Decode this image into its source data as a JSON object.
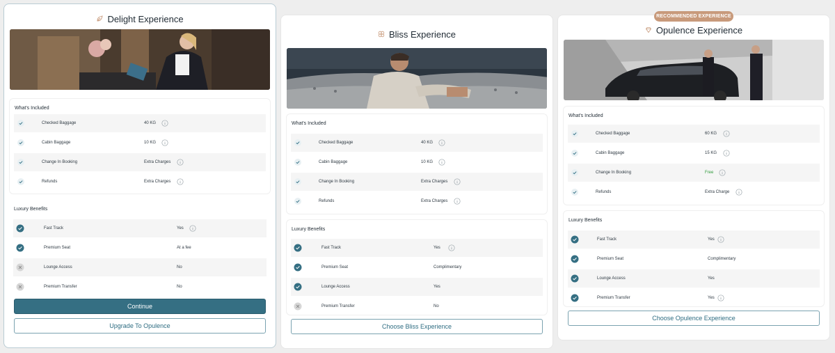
{
  "badge": "RECOMMENDED EXPERIENCE",
  "colors": {
    "accent": "#356f83",
    "check": "#2f6d82",
    "free": "#2e9a3a",
    "badge": "#c89a7b"
  },
  "cards": [
    {
      "title": "Delight Experience",
      "icon": "leaf-icon",
      "hero": "hotel-reception-photo",
      "included_title": "What's Included",
      "included": [
        {
          "label": "Checked Baggage",
          "value": "40 KG"
        },
        {
          "label": "Cabin Baggage",
          "value": "10 KG"
        },
        {
          "label": "Change In Booking",
          "value": "Extra Charges"
        },
        {
          "label": "Refunds",
          "value": "Extra Charges"
        }
      ],
      "benefits_title": "Luxury Benefits",
      "benefits": [
        {
          "label": "Fast Track",
          "value": "Yes",
          "included": true
        },
        {
          "label": "Premium Seat",
          "value": "At a fee",
          "included": true
        },
        {
          "label": "Lounge Access",
          "value": "No",
          "included": false
        },
        {
          "label": "Premium Transfer",
          "value": "No",
          "included": false
        }
      ],
      "primary_button": "Continue",
      "secondary_button": "Upgrade To Opulence"
    },
    {
      "title": "Bliss Experience",
      "icon": "flower-icon",
      "hero": "lounge-sofa-photo",
      "included_title": "What's Included",
      "included": [
        {
          "label": "Checked Baggage",
          "value": "40 KG"
        },
        {
          "label": "Cabin Baggage",
          "value": "10 KG"
        },
        {
          "label": "Change In Booking",
          "value": "Extra Charges"
        },
        {
          "label": "Refunds",
          "value": "Extra Charges"
        }
      ],
      "benefits_title": "Luxury Benefits",
      "benefits": [
        {
          "label": "Fast Track",
          "value": "Yes",
          "included": true
        },
        {
          "label": "Premium Seat",
          "value": "Complimentary",
          "included": true
        },
        {
          "label": "Lounge Access",
          "value": "Yes",
          "included": true
        },
        {
          "label": "Premium Transfer",
          "value": "No",
          "included": false
        }
      ],
      "secondary_button": "Choose Bliss Experience"
    },
    {
      "title": "Opulence Experience",
      "icon": "diamond-icon",
      "hero": "luxury-car-photo",
      "included_title": "What's Included",
      "included": [
        {
          "label": "Checked Baggage",
          "value": "60 KG"
        },
        {
          "label": "Cabin Baggage",
          "value": "15 KG"
        },
        {
          "label": "Change In Booking",
          "value": "Free"
        },
        {
          "label": "Refunds",
          "value": "Extra Charge"
        }
      ],
      "benefits_title": "Luxury Benefits",
      "benefits": [
        {
          "label": "Fast Track",
          "value": "Yes",
          "included": true
        },
        {
          "label": "Premium Seat",
          "value": "Complimentary",
          "included": true
        },
        {
          "label": "Lounge Access",
          "value": "Yes",
          "included": true
        },
        {
          "label": "Premium Transfer",
          "value": "Yes",
          "included": true
        }
      ],
      "secondary_button": "Choose Opulence Experience"
    }
  ]
}
